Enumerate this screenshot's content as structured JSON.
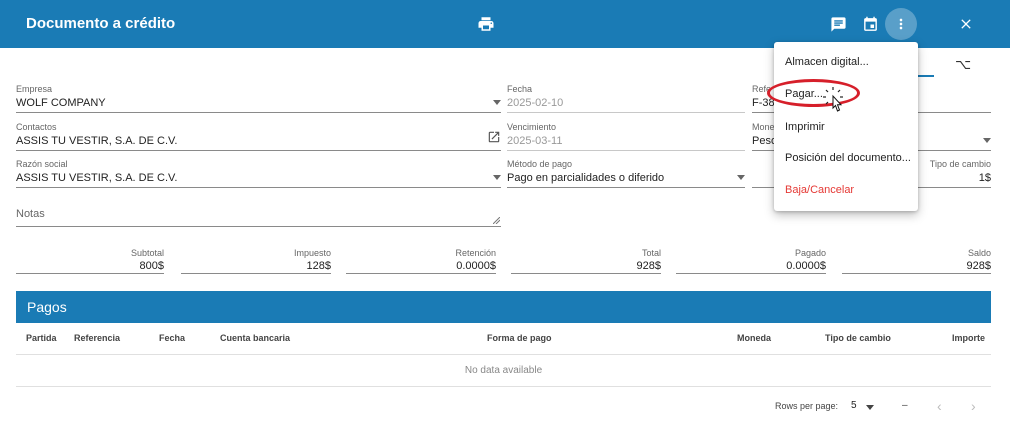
{
  "header": {
    "title": "Documento a crédito",
    "icons": [
      "print-icon",
      "message-icon",
      "calendar-icon",
      "more-vert-icon",
      "close-icon"
    ]
  },
  "form": {
    "empresa": {
      "label": "Empresa",
      "value": "WOLF COMPANY"
    },
    "fecha": {
      "label": "Fecha",
      "value": "2025-02-10"
    },
    "referencia": {
      "label": "Refe",
      "value": "F-38"
    },
    "contactos": {
      "label": "Contactos",
      "value": "ASSIS TU VESTIR, S.A. DE C.V."
    },
    "vencimiento": {
      "label": "Vencimiento",
      "value": "2025-03-11"
    },
    "moneda": {
      "label": "Mone",
      "value": "Peso"
    },
    "razon_social": {
      "label": "Razón social",
      "value": "ASSIS TU VESTIR, S.A. DE C.V."
    },
    "metodo_pago": {
      "label": "Método de pago",
      "value": "Pago en parcialidades o diferido"
    },
    "tipo_cambio": {
      "label": "Tipo de cambio",
      "value": "1$"
    },
    "notas": {
      "label": "Notas"
    }
  },
  "totals": [
    {
      "label": "Subtotal",
      "value": "800$"
    },
    {
      "label": "Impuesto",
      "value": "128$"
    },
    {
      "label": "Retención",
      "value": "0.0000$"
    },
    {
      "label": "Total",
      "value": "928$"
    },
    {
      "label": "Pagado",
      "value": "0.0000$"
    },
    {
      "label": "Saldo",
      "value": "928$"
    }
  ],
  "pagos": {
    "title": "Pagos",
    "columns": [
      "Partida",
      "Referencia",
      "Fecha",
      "Cuenta bancaria",
      "Forma de pago",
      "Moneda",
      "Tipo de cambio",
      "Importe"
    ],
    "empty_text": "No data available",
    "rows_per_page_label": "Rows per page:",
    "rows_per_page": "5",
    "page_range": "–"
  },
  "menu": {
    "items": [
      {
        "label": "Almacen digital..."
      },
      {
        "label": "Pagar..."
      },
      {
        "label": "Imprimir"
      },
      {
        "label": "Posición del documento..."
      },
      {
        "label": "Baja/Cancelar"
      }
    ]
  },
  "colors": {
    "primary": "#1a7bb5",
    "danger": "#e53935",
    "annotation": "#d61f2a"
  }
}
